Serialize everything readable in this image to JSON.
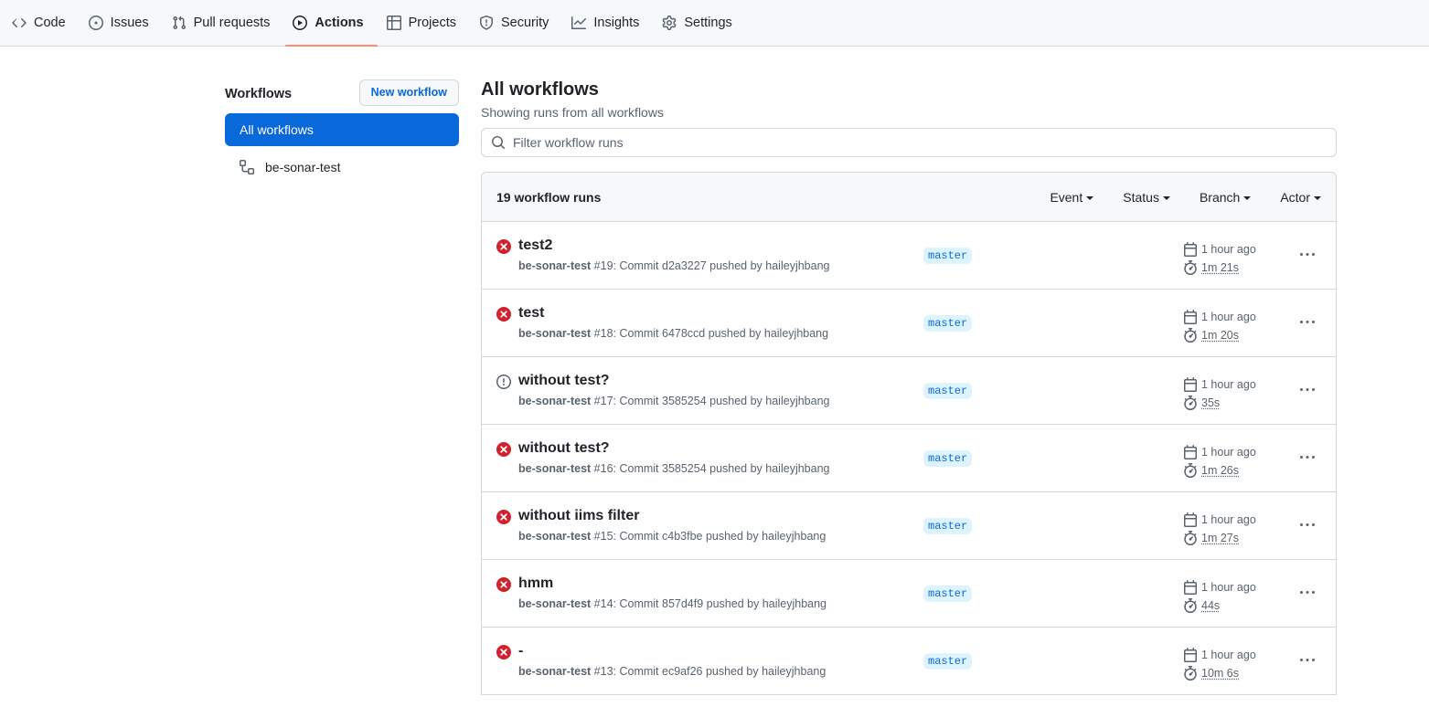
{
  "nav": {
    "items": [
      {
        "label": "Code",
        "icon": "code-icon",
        "active": false
      },
      {
        "label": "Issues",
        "icon": "issue-opened-icon",
        "active": false
      },
      {
        "label": "Pull requests",
        "icon": "git-pull-request-icon",
        "active": false
      },
      {
        "label": "Actions",
        "icon": "play-icon",
        "active": true
      },
      {
        "label": "Projects",
        "icon": "table-icon",
        "active": false
      },
      {
        "label": "Security",
        "icon": "shield-icon",
        "active": false
      },
      {
        "label": "Insights",
        "icon": "graph-icon",
        "active": false
      },
      {
        "label": "Settings",
        "icon": "gear-icon",
        "active": false
      }
    ],
    "active_underline_color": "#fd8c73"
  },
  "sidebar": {
    "title": "Workflows",
    "new_workflow_label": "New workflow",
    "all_workflows_label": "All workflows",
    "workflows": [
      {
        "label": "be-sonar-test",
        "icon": "workflow-icon"
      }
    ]
  },
  "main": {
    "title": "All workflows",
    "subtitle": "Showing runs from all workflows",
    "filter_placeholder": "Filter workflow runs",
    "runs_count_label": "19 workflow runs",
    "filters": [
      "Event",
      "Status",
      "Branch",
      "Actor"
    ]
  },
  "runs": [
    {
      "status": "failure",
      "title": "test2",
      "workflow": "be-sonar-test",
      "meta": " #19: Commit d2a3227 pushed by haileyjhbang",
      "branch": "master",
      "when": "1 hour ago",
      "duration": "1m 21s"
    },
    {
      "status": "failure",
      "title": "test",
      "workflow": "be-sonar-test",
      "meta": " #18: Commit 6478ccd pushed by haileyjhbang",
      "branch": "master",
      "when": "1 hour ago",
      "duration": "1m 20s"
    },
    {
      "status": "warning",
      "title": "without test?",
      "workflow": "be-sonar-test",
      "meta": " #17: Commit 3585254 pushed by haileyjhbang",
      "branch": "master",
      "when": "1 hour ago",
      "duration": "35s"
    },
    {
      "status": "failure",
      "title": "without test?",
      "workflow": "be-sonar-test",
      "meta": " #16: Commit 3585254 pushed by haileyjhbang",
      "branch": "master",
      "when": "1 hour ago",
      "duration": "1m 26s"
    },
    {
      "status": "failure",
      "title": "without iims filter",
      "workflow": "be-sonar-test",
      "meta": " #15: Commit c4b3fbe pushed by haileyjhbang",
      "branch": "master",
      "when": "1 hour ago",
      "duration": "1m 27s"
    },
    {
      "status": "failure",
      "title": "hmm",
      "workflow": "be-sonar-test",
      "meta": " #14: Commit 857d4f9 pushed by haileyjhbang",
      "branch": "master",
      "when": "1 hour ago",
      "duration": "44s"
    },
    {
      "status": "failure",
      "title": "-",
      "workflow": "be-sonar-test",
      "meta": " #13: Commit ec9af26 pushed by haileyjhbang",
      "branch": "master",
      "when": "1 hour ago",
      "duration": "10m 6s"
    }
  ],
  "colors": {
    "accent": "#0969da",
    "failure": "#cf222e",
    "warning": "#59636e",
    "branch_bg": "#ddf4ff"
  }
}
